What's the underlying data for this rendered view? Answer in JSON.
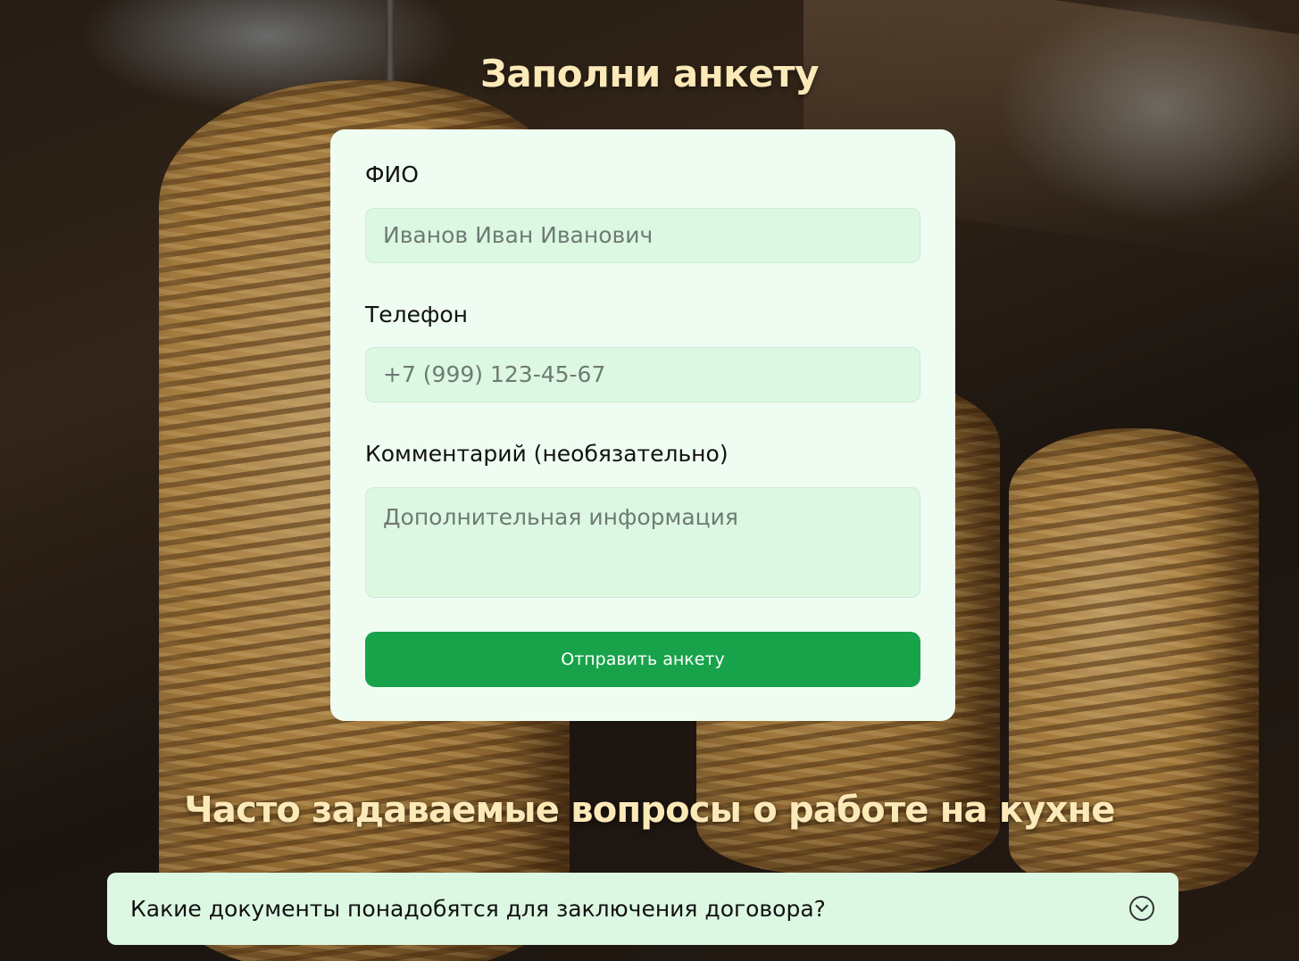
{
  "page": {
    "title": "Заполни анкету"
  },
  "form": {
    "fields": [
      {
        "label": "ФИО",
        "placeholder": "Иванов Иван Иванович"
      },
      {
        "label": "Телефон",
        "placeholder": "+7 (999) 123-45-67"
      },
      {
        "label": "Комментарий (необязательно)",
        "placeholder": "Дополнительная информация"
      }
    ],
    "submit_label": "Отправить анкету"
  },
  "faq": {
    "title": "Часто задаваемые вопросы о работе на кухне",
    "items": [
      {
        "question": "Какие документы понадобятся для заключения договора?",
        "icon": "chevron-down-circle-icon"
      }
    ]
  },
  "colors": {
    "heading": "#fbe9b8",
    "card": "#effcf1",
    "input": "#dcf8e3",
    "accent": "#18a34b"
  }
}
